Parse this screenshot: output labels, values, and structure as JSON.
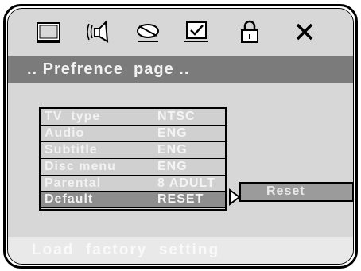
{
  "toolbar": {
    "icons": [
      "tv-icon",
      "speaker-icon",
      "disc-icon",
      "checkbox-icon",
      "lock-icon",
      "close-icon"
    ]
  },
  "page": {
    "title": ".. Prefrence  page .."
  },
  "menu": {
    "items": [
      {
        "label": "TV  type",
        "value": "NTSC"
      },
      {
        "label": "Audio",
        "value": "ENG"
      },
      {
        "label": "Subtitle",
        "value": "ENG"
      },
      {
        "label": "Disc menu",
        "value": "ENG"
      },
      {
        "label": "Parental",
        "value": "8 ADULT"
      },
      {
        "label": "Default",
        "value": "RESET"
      }
    ],
    "selected_index": 5
  },
  "submenu": {
    "reset_label": "Reset"
  },
  "status": {
    "text": "Load  factory  setting"
  }
}
